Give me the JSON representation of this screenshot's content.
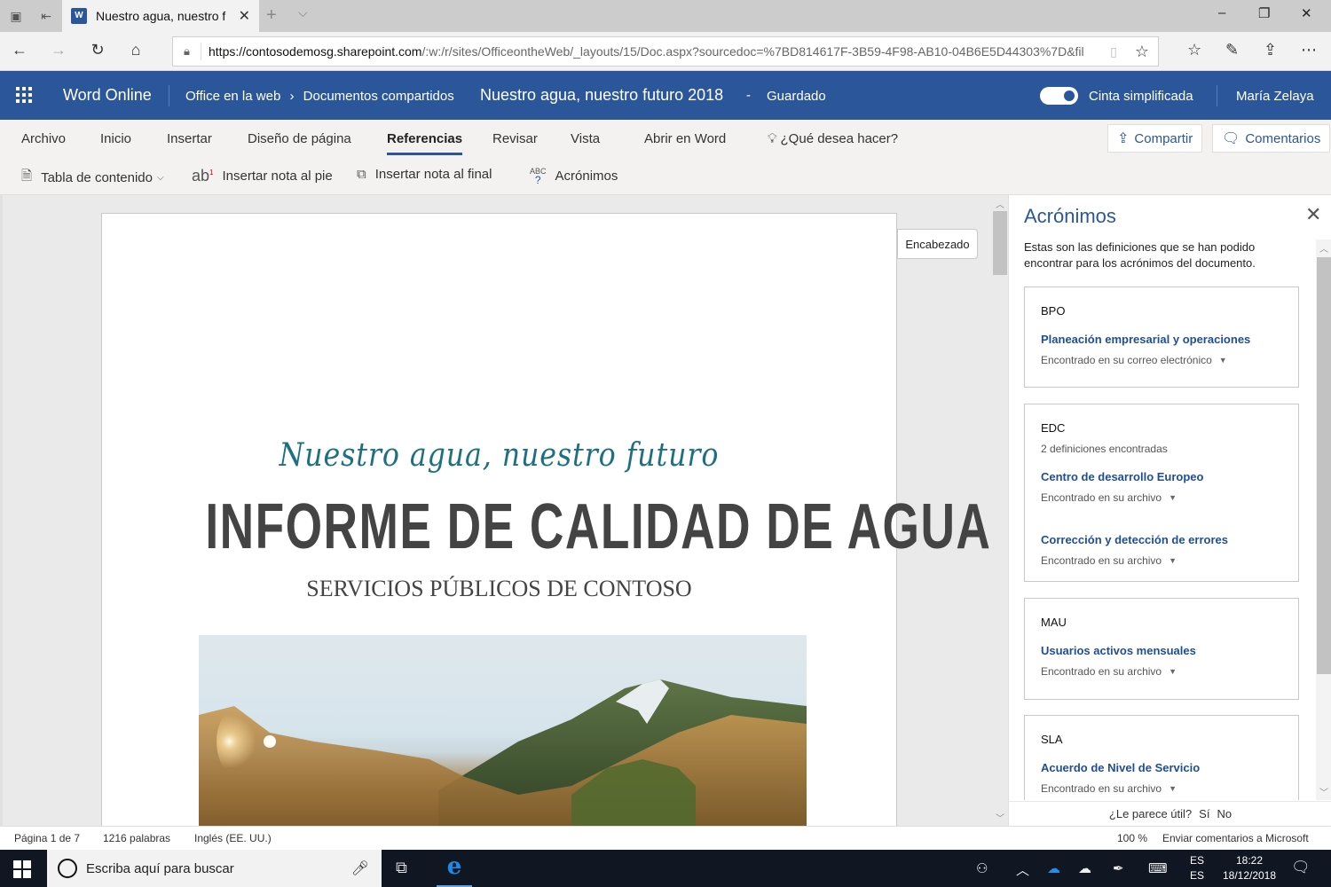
{
  "browser": {
    "tab_title": "Nuestro agua, nuestro f",
    "url_host": "https://contosodemosg.sharepoint.com",
    "url_path": "/:w:/r/sites/OfficeontheWeb/_layouts/15/Doc.aspx?sourcedoc=%7BD814617F-3B59-4F98-AB10-04B6E5D44303%7D&fil"
  },
  "header": {
    "app_name": "Word Online",
    "breadcrumb_root": "Office en la web",
    "breadcrumb_sep": "›",
    "breadcrumb_folder": "Documentos compartidos",
    "doc_title": "Nuestro agua, nuestro futuro 2018",
    "dash": "-",
    "save_status": "Guardado",
    "ribbon_toggle_label": "Cinta simplificada",
    "ribbon_toggle_on": true,
    "user_name": "María Zelaya"
  },
  "ribbon": {
    "tabs": [
      {
        "label": "Archivo"
      },
      {
        "label": "Inicio"
      },
      {
        "label": "Insertar"
      },
      {
        "label": "Diseño de página"
      },
      {
        "label": "Referencias",
        "active": true
      },
      {
        "label": "Revisar"
      },
      {
        "label": "Vista"
      },
      {
        "label": "Abrir en Word"
      }
    ],
    "tell_me": "¿Qué desea hacer?",
    "share_label": "Compartir",
    "comments_label": "Comentarios",
    "commands": {
      "toc": "Tabla de contenido",
      "footnote": "Insertar nota al pie",
      "endnote": "Insertar nota al final",
      "acronyms": "Acrónimos"
    }
  },
  "document": {
    "header_tag": "Encabezado",
    "script_title": "Nuestro agua, nuestro futuro",
    "main_title": "INFORME DE CALIDAD DE AGUA",
    "subtitle": "SERVICIOS PÚBLICOS DE CONTOSO",
    "image_alt": "Paisaje de montaña con río y bosque al atardecer"
  },
  "acronyms_pane": {
    "title": "Acrónimos",
    "description": "Estas son las definiciones que se han podido encontrar para los acrónimos del documento.",
    "cards": [
      {
        "acronym": "BPO",
        "count": "",
        "definitions": [
          {
            "text": "Planeación empresarial y operaciones",
            "source": "Encontrado en su correo electrónico"
          }
        ]
      },
      {
        "acronym": "EDC",
        "count": "2 definiciones encontradas",
        "definitions": [
          {
            "text": "Centro de desarrollo Europeo",
            "source": "Encontrado en su archivo"
          },
          {
            "text": "Corrección y detección de errores",
            "source": "Encontrado en su archivo"
          }
        ]
      },
      {
        "acronym": "MAU",
        "count": "",
        "definitions": [
          {
            "text": "Usuarios activos mensuales",
            "source": "Encontrado en su archivo"
          }
        ]
      },
      {
        "acronym": "SLA",
        "count": "",
        "definitions": [
          {
            "text": "Acuerdo de Nivel de Servicio",
            "source": "Encontrado en su archivo"
          }
        ]
      }
    ],
    "feedback_question": "¿Le parece útil?",
    "feedback_yes": "Sí",
    "feedback_no": "No"
  },
  "statusbar": {
    "page": "Página 1 de 7",
    "words": "1216 palabras",
    "language": "Inglés (EE. UU.)",
    "zoom": "100 %",
    "feedback": "Enviar comentarios a Microsoft"
  },
  "taskbar": {
    "search_placeholder": "Escriba aquí para buscar",
    "input_lang_1": "ES",
    "input_lang_2": "ES",
    "time": "18:22",
    "date": "18/12/2018"
  },
  "colors": {
    "word_brand": "#2b579a",
    "definition_link": "#1f4e96",
    "script_title": "#1f6f83"
  }
}
